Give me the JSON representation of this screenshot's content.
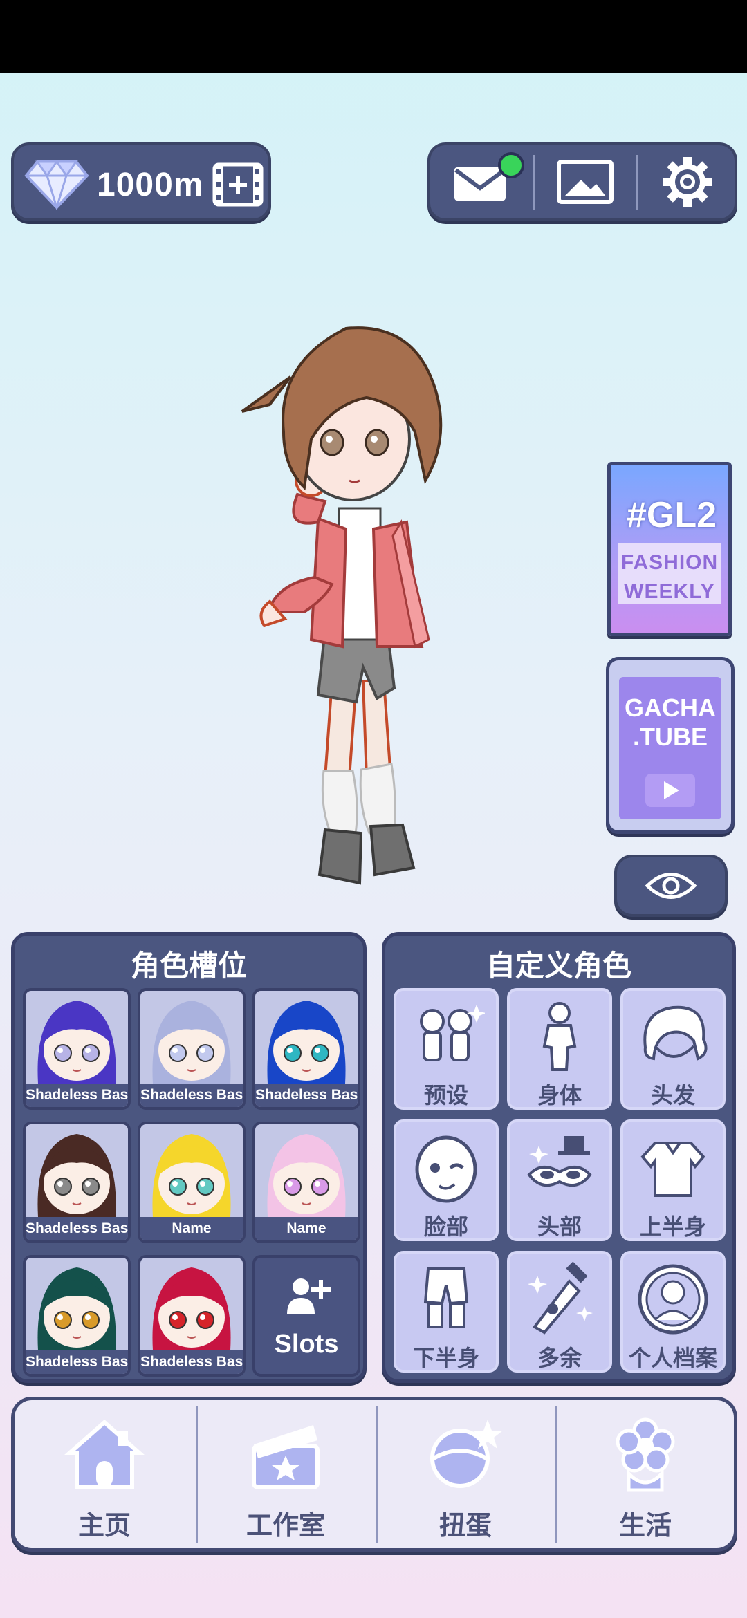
{
  "currency": {
    "amount": "1000m",
    "icon": "diamond-icon",
    "add_icon": "film-plus-icon"
  },
  "top_actions": [
    {
      "name": "mail-icon",
      "has_notification": true
    },
    {
      "name": "gallery-icon"
    },
    {
      "name": "gear-icon"
    }
  ],
  "side": {
    "magazine": {
      "line1": "#GL2",
      "line2": "FASHION",
      "line3": "WEEKLY"
    },
    "tube": {
      "line1": "GACHA",
      "line2": ".TUBE"
    },
    "eye_icon": "eye-icon"
  },
  "slots_panel": {
    "title": "角色槽位",
    "slots": [
      {
        "label": "Shadeless Base",
        "hair": "#4a36c4",
        "eyes": "#b7b3e6"
      },
      {
        "label": "Shadeless Base",
        "hair": "#aab2de",
        "eyes": "#c2c9ee"
      },
      {
        "label": "Shadeless Base",
        "hair": "#1846c8",
        "eyes": "#2fb7c3"
      },
      {
        "label": "Shadeless Base",
        "hair": "#4a2a24",
        "eyes": "#8a8a8a"
      },
      {
        "label": "Name",
        "hair": "#f5d62b",
        "eyes": "#62c9c2"
      },
      {
        "label": "Name",
        "hair": "#f3c3e6",
        "eyes": "#d99ae8"
      },
      {
        "label": "Shadeless Base",
        "hair": "#14514b",
        "eyes": "#d89a2a"
      },
      {
        "label": "Shadeless Base",
        "hair": "#c71441",
        "eyes": "#d6242a"
      }
    ],
    "add_label": "Slots"
  },
  "customize_panel": {
    "title": "自定义角色",
    "items": [
      {
        "label": "预设",
        "icon": "preset-icon"
      },
      {
        "label": "身体",
        "icon": "body-icon"
      },
      {
        "label": "头发",
        "icon": "hair-icon"
      },
      {
        "label": "脸部",
        "icon": "face-icon"
      },
      {
        "label": "头部",
        "icon": "head-accessory-icon"
      },
      {
        "label": "上半身",
        "icon": "upper-body-icon"
      },
      {
        "label": "下半身",
        "icon": "lower-body-icon"
      },
      {
        "label": "多余",
        "icon": "extra-icon"
      },
      {
        "label": "个人档案",
        "icon": "profile-icon"
      }
    ]
  },
  "nav": [
    {
      "label": "主页",
      "icon": "house-icon"
    },
    {
      "label": "工作室",
      "icon": "clapperboard-icon"
    },
    {
      "label": "扭蛋",
      "icon": "gacha-icon"
    },
    {
      "label": "生活",
      "icon": "flower-icon"
    }
  ],
  "colors": {
    "panel": "#4b5680",
    "accent": "#39d45a",
    "tile": "#c8c9f2"
  }
}
